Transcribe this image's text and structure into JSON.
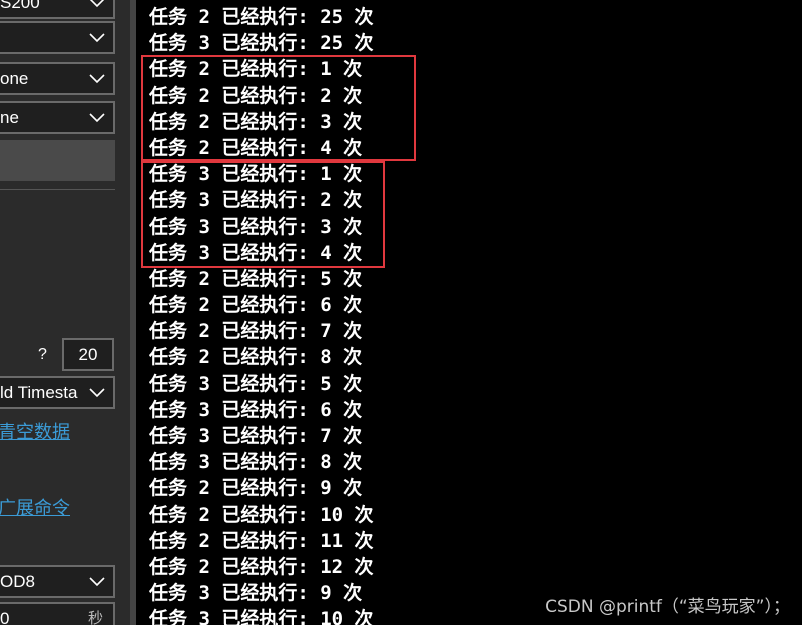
{
  "left_panel": {
    "baudrate_value": "S200",
    "combo2_value": "",
    "parity_value": "one",
    "stopbits_value": "ne",
    "interval_label": "?",
    "interval_value": "20",
    "timestamp_value": "ld Timesta",
    "clear_data_link": "青空数据",
    "extension_link": "广展命令",
    "encoding_value": "OD8",
    "timeout_value": "0",
    "timeout_unit": "秒"
  },
  "console": {
    "lines": [
      "任务 2 已经执行: 25 次",
      "任务 3 已经执行: 25 次",
      "任务 2 已经执行: 1 次",
      "任务 2 已经执行: 2 次",
      "任务 2 已经执行: 3 次",
      "任务 2 已经执行: 4 次",
      "任务 3 已经执行: 1 次",
      "任务 3 已经执行: 2 次",
      "任务 3 已经执行: 3 次",
      "任务 3 已经执行: 4 次",
      "任务 2 已经执行: 5 次",
      "任务 2 已经执行: 6 次",
      "任务 2 已经执行: 7 次",
      "任务 2 已经执行: 8 次",
      "任务 3 已经执行: 5 次",
      "任务 3 已经执行: 6 次",
      "任务 3 已经执行: 7 次",
      "任务 3 已经执行: 8 次",
      "任务 2 已经执行: 9 次",
      "任务 2 已经执行: 10 次",
      "任务 2 已经执行: 11 次",
      "任务 2 已经执行: 12 次",
      "任务 3 已经执行: 9 次",
      "任务 3 已经执行: 10 次"
    ]
  },
  "watermark": "CSDN @printf（“菜鸟玩家”）；",
  "colors": {
    "highlight": "#e0383e",
    "link": "#3b9bd6",
    "console_bg": "#000000",
    "panel_bg": "#2b2b2b"
  }
}
